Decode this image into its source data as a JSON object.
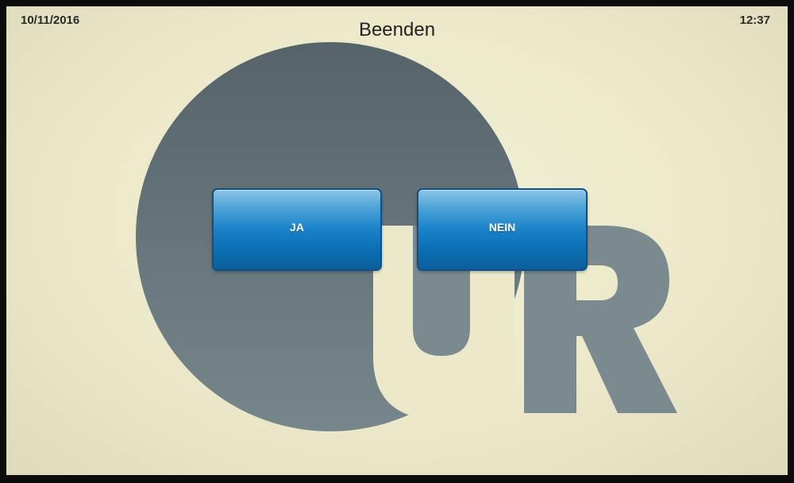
{
  "status_bar": {
    "date": "10/11/2016",
    "time": "12:37"
  },
  "dialog": {
    "title": "Beenden",
    "buttons": {
      "yes_label": "JA",
      "no_label": "NEIN"
    }
  },
  "background_logo": {
    "icon": "ur-logo",
    "color": "#5f6d72",
    "letters": "UR"
  },
  "colors": {
    "screen_background": "#ebe9c9",
    "button_blue": "#1a82c9"
  }
}
